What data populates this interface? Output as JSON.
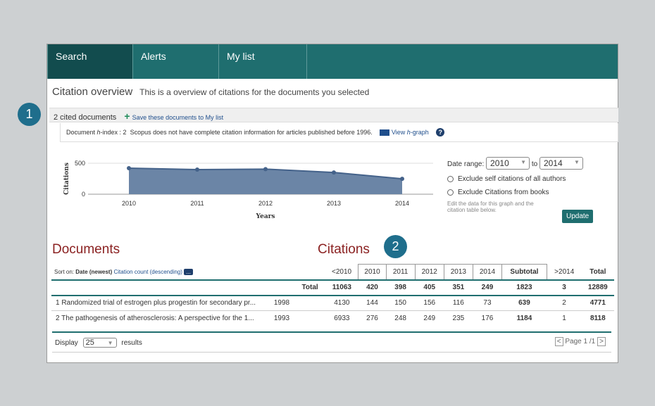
{
  "nav": {
    "tabs": [
      "Search",
      "Alerts",
      "My list"
    ]
  },
  "overview": {
    "title": "Citation overview",
    "subtitle": "This is a overview of citations for the documents you selected"
  },
  "cited_bar": {
    "count_label": "2 cited documents",
    "save_link": "Save these documents to My list"
  },
  "hindex": {
    "label_prefix": "Document ",
    "label_h": "h",
    "label_rest": "-index : 2",
    "note": "Scopus does not have complete citation information for articles published before 1996.",
    "view_prefix": "View ",
    "view_h": "h",
    "view_rest": "-graph",
    "help": "?"
  },
  "chart_data": {
    "type": "area",
    "x": [
      "2010",
      "2011",
      "2012",
      "2013",
      "2014"
    ],
    "series": [
      {
        "values": [
          420,
          398,
          405,
          351,
          249
        ]
      }
    ],
    "xlabel": "Years",
    "ylabel": "Citations",
    "yticks": [
      "0",
      "500"
    ],
    "ylim": [
      0,
      500
    ]
  },
  "date_range": {
    "label": "Date range:",
    "from": "2010",
    "to_label": "to",
    "to": "2014"
  },
  "options": {
    "self": "Exclude self citations of all authors",
    "books": "Exclude Citations from books",
    "note": "Edit the data for this graph and the citation table below.",
    "update": "Update"
  },
  "sections": {
    "documents": "Documents",
    "citations": "Citations"
  },
  "sort": {
    "label": "Sort on:",
    "date": "Date (newest)",
    "citation": "Citation count (descending)",
    "more": "..."
  },
  "table": {
    "headers": [
      "<2010",
      "2010",
      "2011",
      "2012",
      "2013",
      "2014",
      "Subtotal",
      ">2014",
      "Total"
    ],
    "total_row": {
      "label": "Total",
      "values": [
        "11063",
        "420",
        "398",
        "405",
        "351",
        "249",
        "1823",
        "3",
        "12889"
      ]
    },
    "rows": [
      {
        "title": "1 Randomized trial of estrogen plus progestin for secondary pr...",
        "year": "1998",
        "values": [
          "4130",
          "144",
          "150",
          "156",
          "116",
          "73",
          "639",
          "2",
          "4771"
        ]
      },
      {
        "title": "2 The pathogenesis of atherosclerosis: A perspective for the 1...",
        "year": "1993",
        "values": [
          "6933",
          "276",
          "248",
          "249",
          "235",
          "176",
          "1184",
          "1",
          "8118"
        ]
      }
    ]
  },
  "footer": {
    "display": "Display",
    "per_page": "25",
    "results": "results",
    "page_label": "Page 1",
    "page_total": "/1"
  },
  "markers": [
    "1",
    "2"
  ]
}
